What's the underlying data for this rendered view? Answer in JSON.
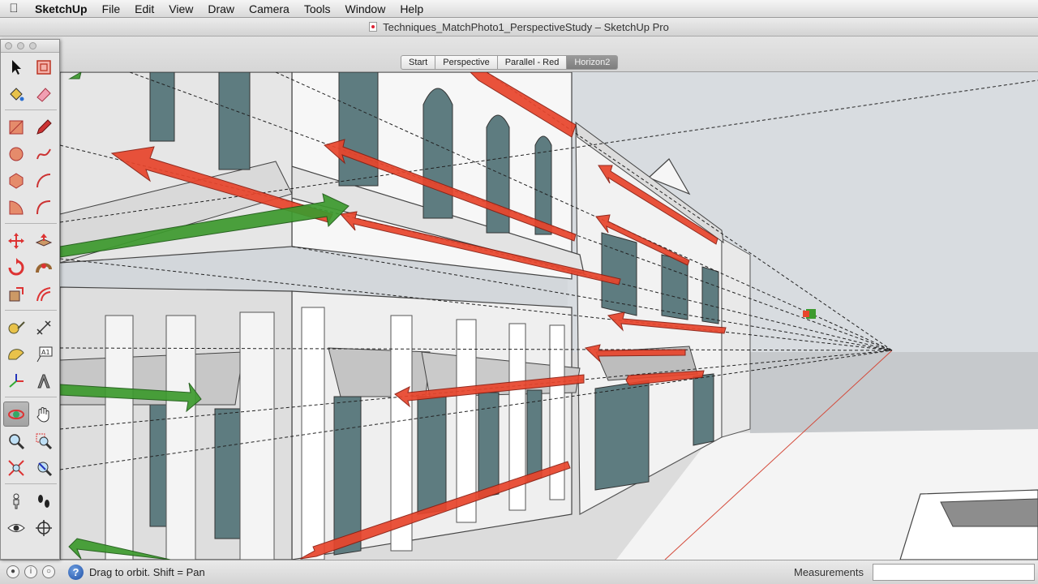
{
  "menubar": {
    "items": [
      "SketchUp",
      "File",
      "Edit",
      "View",
      "Draw",
      "Camera",
      "Tools",
      "Window",
      "Help"
    ]
  },
  "window": {
    "title": "Techniques_MatchPhoto1_PerspectiveStudy – SketchUp Pro"
  },
  "scene_tabs": [
    {
      "label": "Start",
      "active": false
    },
    {
      "label": "Perspective",
      "active": false
    },
    {
      "label": "Parallel - Red",
      "active": false
    },
    {
      "label": "Horizon2",
      "active": true
    }
  ],
  "tools": [
    {
      "name": "select",
      "icon": "arrow-icon"
    },
    {
      "name": "make-component",
      "icon": "component-icon"
    },
    {
      "name": "paint-bucket",
      "icon": "paint-bucket-icon"
    },
    {
      "name": "eraser",
      "icon": "eraser-icon"
    },
    {
      "name": "rectangle",
      "icon": "rectangle-icon"
    },
    {
      "name": "line",
      "icon": "pencil-icon"
    },
    {
      "name": "circle",
      "icon": "circle-icon"
    },
    {
      "name": "freehand",
      "icon": "freehand-icon"
    },
    {
      "name": "polygon",
      "icon": "polygon-icon"
    },
    {
      "name": "arc",
      "icon": "arc-icon"
    },
    {
      "name": "pie",
      "icon": "pie-icon"
    },
    {
      "name": "arc-3pt",
      "icon": "arc-3pt-icon"
    },
    {
      "name": "move",
      "icon": "move-icon"
    },
    {
      "name": "push-pull",
      "icon": "push-pull-icon"
    },
    {
      "name": "rotate",
      "icon": "rotate-icon"
    },
    {
      "name": "follow-me",
      "icon": "follow-me-icon"
    },
    {
      "name": "scale",
      "icon": "scale-icon"
    },
    {
      "name": "offset",
      "icon": "offset-icon"
    },
    {
      "name": "tape-measure",
      "icon": "tape-measure-icon"
    },
    {
      "name": "dimension",
      "icon": "dimension-icon"
    },
    {
      "name": "protractor",
      "icon": "protractor-icon"
    },
    {
      "name": "text",
      "icon": "text-label-icon"
    },
    {
      "name": "axes",
      "icon": "axes-icon"
    },
    {
      "name": "3d-text",
      "icon": "3d-text-icon"
    },
    {
      "name": "orbit",
      "icon": "orbit-icon",
      "selected": true
    },
    {
      "name": "pan",
      "icon": "hand-icon"
    },
    {
      "name": "zoom",
      "icon": "zoom-icon"
    },
    {
      "name": "zoom-window",
      "icon": "zoom-window-icon"
    },
    {
      "name": "zoom-extents",
      "icon": "zoom-extents-icon"
    },
    {
      "name": "previous-view",
      "icon": "previous-view-icon"
    },
    {
      "name": "position-camera",
      "icon": "position-camera-icon"
    },
    {
      "name": "walk",
      "icon": "footprints-icon"
    },
    {
      "name": "look-around",
      "icon": "eye-icon"
    },
    {
      "name": "section-plane",
      "icon": "section-plane-icon"
    }
  ],
  "status": {
    "text": "Drag to orbit.  Shift = Pan",
    "measurements_label": "Measurements",
    "measurements_value": ""
  },
  "colors": {
    "red_axis_arrow": "#e8452c",
    "green_axis_arrow": "#3d9a2e",
    "sky": "#d4d8dc",
    "glass": "#5e7c80"
  }
}
